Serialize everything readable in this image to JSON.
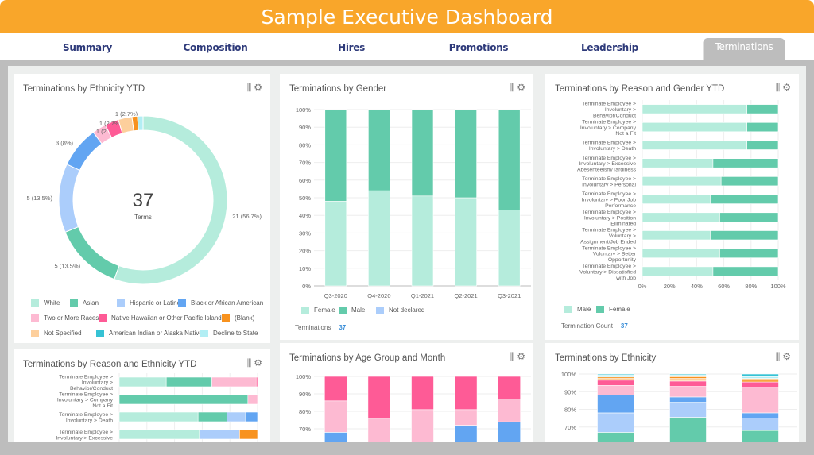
{
  "header": {
    "title": "Sample Executive Dashboard"
  },
  "tabs": [
    {
      "label": "Summary"
    },
    {
      "label": "Composition"
    },
    {
      "label": "Hires"
    },
    {
      "label": "Promotions"
    },
    {
      "label": "Leadership"
    },
    {
      "label": "Terminations",
      "active": true
    }
  ],
  "icons": {
    "settings_sliders": "sliders-icon",
    "gear": "gear-icon"
  },
  "colors": {
    "White": "#b5ecdc",
    "Asian": "#63cbab",
    "Hispanic or Latino": "#abcdfb",
    "Black or African American": "#62a5f2",
    "Two or More Races": "#fdbad2",
    "Native Hawaiian or Other Pacific Islander": "#fe5b96",
    "(Blank)": "#f8921e",
    "Not Specified": "#fdcf9c",
    "American Indian or Alaska Native": "#36c2d4",
    "Decline to State": "#b2eef4",
    "header": "#f9a62a"
  },
  "cards": {
    "eth_ytd": {
      "title": "Terminations by Ethnicity YTD",
      "center_value": "37",
      "center_label": "Terms"
    },
    "gender": {
      "title": "Terminations by Gender",
      "footer_label": "Terminations",
      "footer_value": "37"
    },
    "reason_gender": {
      "title": "Terminations by Reason and Gender YTD",
      "footer_label": "Termination Count",
      "footer_value": "37"
    },
    "reason_eth": {
      "title": "Terminations by Reason and Ethnicity YTD"
    },
    "age": {
      "title": "Terminations by Age Group and Month"
    },
    "eth": {
      "title": "Terminations by Ethnicity"
    }
  },
  "chart_data": [
    {
      "id": "eth_ytd",
      "type": "pie",
      "donut": true,
      "slices": [
        {
          "name": "White",
          "value": 21,
          "label": "21 (56.7%)"
        },
        {
          "name": "Asian",
          "value": 5,
          "label": "5 (13.5%)"
        },
        {
          "name": "Hispanic or Latino",
          "value": 5,
          "label": "5 (13.5%)"
        },
        {
          "name": "Black or African American",
          "value": 3,
          "label": "3 (8%)"
        },
        {
          "name": "Two or More Races",
          "value": 1,
          "label": "1 (2.7%)"
        },
        {
          "name": "Native Hawaiian or Other Pacific Islander",
          "value": 1,
          "label": "1 (2.7%)"
        },
        {
          "name": "Not Specified",
          "value": 1,
          "label": "1 (2.7%)"
        },
        {
          "name": "(Blank)",
          "value": 0.4,
          "label": ""
        },
        {
          "name": "Decline to State",
          "value": 0.4,
          "label": ""
        }
      ],
      "legend": [
        "White",
        "Asian",
        "Hispanic or Latino",
        "Black or African American",
        "Two or More Races",
        "Native Hawaiian or Other Pacific Islander",
        "(Blank)",
        "Not Specified",
        "American Indian or Alaska Native",
        "Decline to State"
      ],
      "legend_position": "bottom"
    },
    {
      "id": "gender",
      "type": "bar",
      "stacked": true,
      "percent": true,
      "categories": [
        "Q3-2020",
        "Q4-2020",
        "Q1-2021",
        "Q2-2021",
        "Q3-2021"
      ],
      "series": [
        {
          "name": "Female",
          "values": [
            48,
            54,
            51,
            50,
            43
          ]
        },
        {
          "name": "Male",
          "values": [
            52,
            46,
            49,
            50,
            57
          ]
        },
        {
          "name": "Not declared",
          "values": [
            0,
            0,
            0,
            0,
            0
          ]
        }
      ],
      "yticks": [
        "0%",
        "10%",
        "20%",
        "30%",
        "40%",
        "50%",
        "60%",
        "70%",
        "80%",
        "90%",
        "100%"
      ],
      "ylim": [
        0,
        100
      ],
      "grid": true,
      "legend_position": "bottom"
    },
    {
      "id": "reason_gender",
      "type": "bar",
      "orientation": "horizontal",
      "stacked": true,
      "percent": true,
      "categories": [
        "Terminate Employee > Involuntary > Behavior/Conduct",
        "Terminate Employee > Involuntary > Company Not a Fit",
        "Terminate Employee > Involuntary > Death",
        "Terminate Employee > Involuntary > Excessive Abesenteeism/Tardiness",
        "Terminate Employee > Involuntary > Personal",
        "Terminate Employee > Involuntary > Poor Job Performance",
        "Terminate Employee > Involuntary > Position Eliminated",
        "Terminate Employee > Voluntary > Assignment/Job Ended",
        "Terminate Employee > Voluntary > Better Opportunity",
        "Terminate Employee > Voluntary > Dissatisfied with Job"
      ],
      "category_lines": [
        [
          "Terminate Employee >",
          "Involuntary >",
          "Behavior/Conduct"
        ],
        [
          "Terminate Employee >",
          "Involuntary > Company",
          "Not a Fit"
        ],
        [
          "Terminate Employee >",
          "Involuntary > Death"
        ],
        [
          "Terminate Employee >",
          "Involuntary > Excessive",
          "Abesenteeism/Tardiness"
        ],
        [
          "Terminate Employee >",
          "Involuntary > Personal"
        ],
        [
          "Terminate Employee >",
          "Involuntary > Poor Job",
          "Performance"
        ],
        [
          "Terminate Employee >",
          "Involuntary > Position",
          "Eliminated"
        ],
        [
          "Terminate Employee >",
          "Voluntary >",
          "Assignment/Job Ended"
        ],
        [
          "Terminate Employee >",
          "Voluntary > Better",
          "Opportunity"
        ],
        [
          "Terminate Employee >",
          "Voluntary > Dissatisfied",
          "with Job"
        ]
      ],
      "series": [
        {
          "name": "Male",
          "values": [
            77,
            77,
            77,
            52,
            58,
            50,
            57,
            50,
            57,
            52
          ]
        },
        {
          "name": "Female",
          "values": [
            23,
            23,
            23,
            48,
            42,
            50,
            43,
            50,
            43,
            48
          ]
        }
      ],
      "xticks": [
        "0%",
        "20%",
        "40%",
        "60%",
        "80%",
        "100%"
      ],
      "xlim": [
        0,
        100
      ],
      "legend_position": "bottom"
    },
    {
      "id": "reason_eth",
      "type": "bar",
      "orientation": "horizontal",
      "stacked": true,
      "percent": true,
      "category_lines": [
        [
          "Terminate Employee >",
          "Involuntary >",
          "Behavior/Conduct"
        ],
        [
          "Terminate Employee >",
          "Involuntary > Company",
          "Not a Fit"
        ],
        [
          "Terminate Employee >",
          "Involuntary > Death"
        ],
        [
          "Terminate Employee >",
          "Involuntary > Excessive"
        ]
      ],
      "rows": [
        [
          [
            "White",
            34
          ],
          [
            "Asian",
            33
          ],
          [
            "Two or More Races",
            32
          ],
          [
            "Native Hawaiian or Other Pacific Islander",
            1
          ]
        ],
        [
          [
            "Asian",
            93
          ],
          [
            "Two or More Races",
            7
          ]
        ],
        [
          [
            "White",
            57
          ],
          [
            "Asian",
            21
          ],
          [
            "Hispanic or Latino",
            13
          ],
          [
            "Black or African American",
            9
          ]
        ],
        [
          [
            "White",
            58
          ],
          [
            "Hispanic or Latino",
            29
          ],
          [
            "(Blank)",
            13
          ]
        ]
      ]
    },
    {
      "id": "age",
      "type": "bar",
      "stacked": true,
      "percent": true,
      "yticks": [
        "70%",
        "80%",
        "90%",
        "100%"
      ],
      "ylim": [
        60,
        100
      ],
      "bars": [
        [
          [
            "#62a5f2",
            68
          ],
          [
            "#fdbad2",
            86
          ],
          [
            "#fe5b96",
            100
          ]
        ],
        [
          [
            "#fdbad2",
            76
          ],
          [
            "#fe5b96",
            100
          ]
        ],
        [
          [
            "#fdbad2",
            81
          ],
          [
            "#fe5b96",
            100
          ]
        ],
        [
          [
            "#62a5f2",
            72
          ],
          [
            "#fdbad2",
            81
          ],
          [
            "#fe5b96",
            100
          ]
        ],
        [
          [
            "#62a5f2",
            74
          ],
          [
            "#fdbad2",
            87
          ],
          [
            "#fe5b96",
            100
          ]
        ]
      ]
    },
    {
      "id": "eth",
      "type": "bar",
      "stacked": true,
      "percent": true,
      "yticks": [
        "70%",
        "80%",
        "90%",
        "100%"
      ],
      "ylim": [
        60,
        100
      ],
      "bars": [
        [
          [
            "Asian",
            67
          ],
          [
            "Hispanic or Latino",
            78
          ],
          [
            "Black or African American",
            88
          ],
          [
            "Two or More Races",
            93.5
          ],
          [
            "Native Hawaiian or Other Pacific Islander",
            96.5
          ],
          [
            "Not Specified",
            97.5
          ],
          [
            "(Blank)",
            98.3
          ],
          [
            "Decline to State",
            99.5
          ],
          [
            "American Indian or Alaska Native",
            100
          ]
        ],
        [
          [
            "Asian",
            75.5
          ],
          [
            "Hispanic or Latino",
            84
          ],
          [
            "Black or African American",
            87
          ],
          [
            "Two or More Races",
            93
          ],
          [
            "Native Hawaiian or Other Pacific Islander",
            96
          ],
          [
            "Not Specified",
            97.5
          ],
          [
            "(Blank)",
            98.5
          ],
          [
            "Decline to State",
            99.5
          ],
          [
            "American Indian or Alaska Native",
            100
          ]
        ],
        [
          [
            "Asian",
            68
          ],
          [
            "Hispanic or Latino",
            75
          ],
          [
            "Black or African American",
            78
          ],
          [
            "Two or More Races",
            92.5
          ],
          [
            "Native Hawaiian or Other Pacific Islander",
            95.5
          ],
          [
            "(Blank)",
            96.5
          ],
          [
            "Not Specified",
            97.5
          ],
          [
            "Decline to State",
            98.5
          ],
          [
            "American Indian or Alaska Native",
            100
          ]
        ]
      ]
    }
  ]
}
